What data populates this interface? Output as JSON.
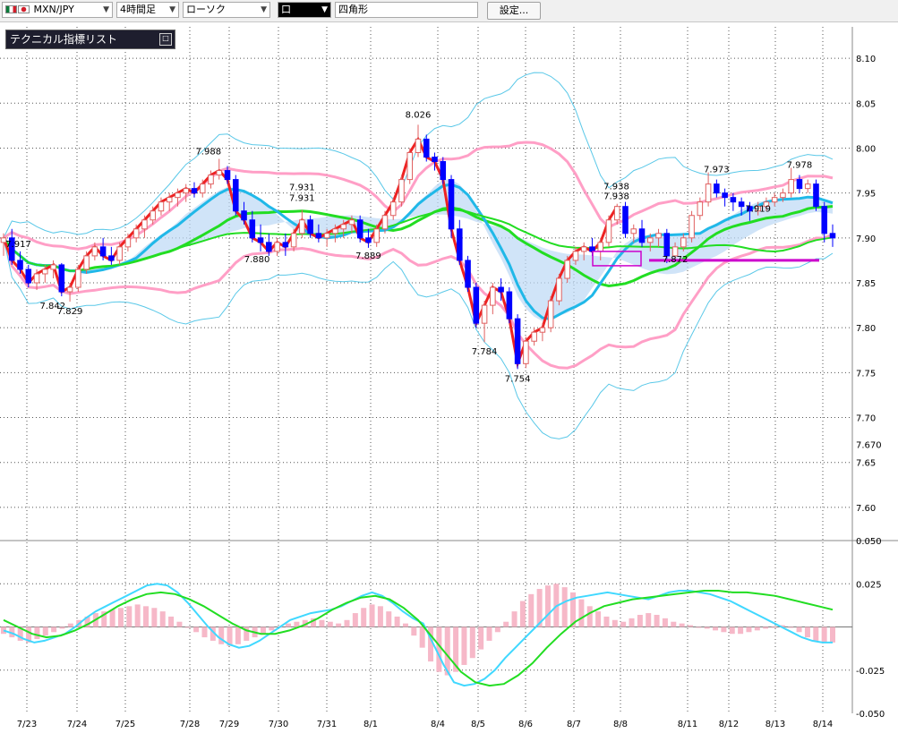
{
  "toolbar": {
    "symbol": "MXN/JPY",
    "timeframe": "4時間足",
    "chart_type": "ローソク",
    "draw_color_label": "口",
    "draw_tool": "四角形",
    "settings_label": "設定..."
  },
  "indicator_panel": {
    "title": "テクニカル指標リスト"
  },
  "colors": {
    "bull": "#ff8a8a",
    "bear": "#0000ff",
    "bb_outer": "#5ac8e8",
    "bb_mid": "#ff9fc6",
    "ma_green": "#22dd22",
    "ma_cyan": "#20b8e8",
    "lagging": "#ee2222",
    "cloud_blue": "#bcd9f5",
    "cloud_pink": "#f8c8da",
    "hist": "#f6b8c8",
    "hline": "#cc00cc"
  },
  "chart_data": [
    {
      "type": "candlestick",
      "y_ticks": [
        "8.10",
        "8.05",
        "8.00",
        "7.95",
        "7.90",
        "7.85",
        "7.80",
        "7.75",
        "7.70",
        "7.670",
        "7.65",
        "7.60"
      ],
      "x_ticks": [
        "7/23",
        "7/24",
        "7/25",
        "7/28",
        "7/29",
        "7/30",
        "7/31",
        "8/1",
        "8/4",
        "8/5",
        "8/6",
        "8/7",
        "8/8",
        "8/11",
        "8/12",
        "8/13",
        "8/14"
      ],
      "ylim": [
        7.565,
        8.135
      ],
      "annotations": [
        "7.917",
        "7.842",
        "7.829",
        "7.988",
        "7.931",
        "7.931",
        "7.880",
        "7.889",
        "8.026",
        "7.784",
        "7.754",
        "7.938",
        "7.938",
        "7.872",
        "7.973",
        "7.919",
        "7.978"
      ],
      "horizontal_line": 7.875,
      "candles": [
        [
          7.895,
          7.905,
          7.88,
          7.9
        ],
        [
          7.9,
          7.91,
          7.87,
          7.875
        ],
        [
          7.875,
          7.885,
          7.86,
          7.865
        ],
        [
          7.865,
          7.87,
          7.845,
          7.85
        ],
        [
          7.85,
          7.865,
          7.842,
          7.86
        ],
        [
          7.86,
          7.87,
          7.85,
          7.865
        ],
        [
          7.865,
          7.875,
          7.855,
          7.87
        ],
        [
          7.87,
          7.872,
          7.835,
          7.84
        ],
        [
          7.84,
          7.85,
          7.829,
          7.845
        ],
        [
          7.845,
          7.87,
          7.84,
          7.865
        ],
        [
          7.865,
          7.885,
          7.86,
          7.88
        ],
        [
          7.88,
          7.895,
          7.875,
          7.89
        ],
        [
          7.89,
          7.9,
          7.875,
          7.88
        ],
        [
          7.88,
          7.89,
          7.87,
          7.875
        ],
        [
          7.875,
          7.895,
          7.87,
          7.89
        ],
        [
          7.89,
          7.905,
          7.885,
          7.9
        ],
        [
          7.9,
          7.915,
          7.895,
          7.91
        ],
        [
          7.91,
          7.925,
          7.9,
          7.92
        ],
        [
          7.92,
          7.935,
          7.915,
          7.93
        ],
        [
          7.93,
          7.945,
          7.925,
          7.94
        ],
        [
          7.94,
          7.95,
          7.93,
          7.945
        ],
        [
          7.945,
          7.955,
          7.935,
          7.95
        ],
        [
          7.95,
          7.96,
          7.94,
          7.955
        ],
        [
          7.955,
          7.962,
          7.945,
          7.95
        ],
        [
          7.95,
          7.965,
          7.945,
          7.96
        ],
        [
          7.96,
          7.975,
          7.955,
          7.97
        ],
        [
          7.97,
          7.988,
          7.965,
          7.975
        ],
        [
          7.975,
          7.98,
          7.96,
          7.965
        ],
        [
          7.965,
          7.97,
          7.925,
          7.93
        ],
        [
          7.93,
          7.94,
          7.915,
          7.92
        ],
        [
          7.92,
          7.93,
          7.895,
          7.9
        ],
        [
          7.9,
          7.915,
          7.885,
          7.895
        ],
        [
          7.895,
          7.905,
          7.88,
          7.885
        ],
        [
          7.885,
          7.9,
          7.88,
          7.895
        ],
        [
          7.895,
          7.905,
          7.88,
          7.89
        ],
        [
          7.89,
          7.91,
          7.885,
          7.905
        ],
        [
          7.905,
          7.931,
          7.9,
          7.92
        ],
        [
          7.92,
          7.925,
          7.9,
          7.905
        ],
        [
          7.905,
          7.915,
          7.895,
          7.9
        ],
        [
          7.9,
          7.91,
          7.89,
          7.905
        ],
        [
          7.905,
          7.915,
          7.895,
          7.91
        ],
        [
          7.91,
          7.92,
          7.9,
          7.915
        ],
        [
          7.915,
          7.925,
          7.905,
          7.92
        ],
        [
          7.92,
          7.925,
          7.895,
          7.9
        ],
        [
          7.9,
          7.91,
          7.889,
          7.895
        ],
        [
          7.895,
          7.915,
          7.89,
          7.91
        ],
        [
          7.91,
          7.93,
          7.905,
          7.925
        ],
        [
          7.925,
          7.945,
          7.92,
          7.94
        ],
        [
          7.94,
          7.97,
          7.935,
          7.965
        ],
        [
          7.965,
          8.0,
          7.96,
          7.995
        ],
        [
          7.995,
          8.026,
          7.99,
          8.01
        ],
        [
          8.01,
          8.015,
          7.985,
          7.99
        ],
        [
          7.99,
          7.995,
          7.975,
          7.985
        ],
        [
          7.985,
          7.99,
          7.96,
          7.965
        ],
        [
          7.965,
          7.97,
          7.9,
          7.91
        ],
        [
          7.91,
          7.92,
          7.87,
          7.875
        ],
        [
          7.875,
          7.88,
          7.84,
          7.845
        ],
        [
          7.845,
          7.85,
          7.8,
          7.805
        ],
        [
          7.805,
          7.83,
          7.784,
          7.825
        ],
        [
          7.825,
          7.85,
          7.815,
          7.845
        ],
        [
          7.845,
          7.855,
          7.83,
          7.84
        ],
        [
          7.84,
          7.845,
          7.805,
          7.81
        ],
        [
          7.81,
          7.815,
          7.754,
          7.76
        ],
        [
          7.76,
          7.79,
          7.755,
          7.785
        ],
        [
          7.785,
          7.8,
          7.78,
          7.795
        ],
        [
          7.795,
          7.805,
          7.785,
          7.8
        ],
        [
          7.8,
          7.835,
          7.795,
          7.83
        ],
        [
          7.83,
          7.86,
          7.825,
          7.855
        ],
        [
          7.855,
          7.88,
          7.85,
          7.875
        ],
        [
          7.875,
          7.89,
          7.87,
          7.885
        ],
        [
          7.885,
          7.895,
          7.875,
          7.89
        ],
        [
          7.89,
          7.9,
          7.88,
          7.885
        ],
        [
          7.885,
          7.9,
          7.875,
          7.895
        ],
        [
          7.895,
          7.925,
          7.89,
          7.92
        ],
        [
          7.92,
          7.938,
          7.915,
          7.935
        ],
        [
          7.935,
          7.94,
          7.9,
          7.905
        ],
        [
          7.905,
          7.915,
          7.895,
          7.91
        ],
        [
          7.91,
          7.92,
          7.89,
          7.895
        ],
        [
          7.895,
          7.905,
          7.885,
          7.9
        ],
        [
          7.9,
          7.91,
          7.89,
          7.905
        ],
        [
          7.905,
          7.91,
          7.872,
          7.88
        ],
        [
          7.88,
          7.895,
          7.875,
          7.89
        ],
        [
          7.89,
          7.905,
          7.885,
          7.9
        ],
        [
          7.9,
          7.93,
          7.895,
          7.925
        ],
        [
          7.925,
          7.945,
          7.92,
          7.94
        ],
        [
          7.94,
          7.973,
          7.935,
          7.96
        ],
        [
          7.96,
          7.965,
          7.945,
          7.95
        ],
        [
          7.95,
          7.955,
          7.935,
          7.945
        ],
        [
          7.945,
          7.95,
          7.93,
          7.94
        ],
        [
          7.94,
          7.945,
          7.925,
          7.935
        ],
        [
          7.935,
          7.94,
          7.919,
          7.93
        ],
        [
          7.93,
          7.94,
          7.925,
          7.935
        ],
        [
          7.935,
          7.945,
          7.93,
          7.94
        ],
        [
          7.94,
          7.95,
          7.935,
          7.945
        ],
        [
          7.945,
          7.955,
          7.94,
          7.95
        ],
        [
          7.95,
          7.978,
          7.945,
          7.965
        ],
        [
          7.965,
          7.97,
          7.95,
          7.955
        ],
        [
          7.955,
          7.965,
          7.95,
          7.96
        ],
        [
          7.96,
          7.965,
          7.93,
          7.935
        ],
        [
          7.935,
          7.94,
          7.895,
          7.905
        ],
        [
          7.905,
          7.915,
          7.89,
          7.9
        ]
      ]
    },
    {
      "type": "macd",
      "y_ticks": [
        "0.050",
        "0.025",
        "-0.025",
        "-0.050"
      ],
      "ylim": [
        -0.05,
        0.05
      ],
      "histogram": [
        -0.004,
        -0.006,
        -0.008,
        -0.009,
        -0.007,
        -0.005,
        -0.003,
        -0.001,
        0.002,
        0.004,
        0.006,
        0.008,
        0.009,
        0.01,
        0.011,
        0.012,
        0.013,
        0.012,
        0.011,
        0.009,
        0.006,
        0.003,
        0.0,
        -0.003,
        -0.006,
        -0.008,
        -0.01,
        -0.011,
        -0.01,
        -0.008,
        -0.006,
        -0.004,
        -0.002,
        0.0,
        0.002,
        0.003,
        0.004,
        0.005,
        0.004,
        0.003,
        0.002,
        0.004,
        0.008,
        0.011,
        0.013,
        0.012,
        0.009,
        0.006,
        0.002,
        -0.005,
        -0.012,
        -0.02,
        -0.026,
        -0.028,
        -0.026,
        -0.022,
        -0.018,
        -0.013,
        -0.008,
        -0.003,
        0.003,
        0.009,
        0.015,
        0.019,
        0.022,
        0.024,
        0.025,
        0.023,
        0.02,
        0.016,
        0.012,
        0.009,
        0.006,
        0.004,
        0.003,
        0.005,
        0.007,
        0.008,
        0.007,
        0.005,
        0.003,
        0.002,
        0.001,
        0.0,
        -0.001,
        -0.002,
        -0.003,
        -0.004,
        -0.004,
        -0.003,
        -0.002,
        -0.001,
        0.0,
        0.001,
        0.0,
        -0.003,
        -0.006,
        -0.008,
        -0.009,
        -0.009
      ],
      "macd": [
        -0.002,
        -0.004,
        -0.007,
        -0.009,
        -0.008,
        -0.006,
        -0.004,
        0.0,
        0.005,
        0.009,
        0.012,
        0.015,
        0.018,
        0.021,
        0.024,
        0.025,
        0.024,
        0.02,
        0.014,
        0.007,
        0.0,
        -0.006,
        -0.01,
        -0.012,
        -0.011,
        -0.008,
        -0.004,
        0.0,
        0.004,
        0.006,
        0.008,
        0.009,
        0.01,
        0.012,
        0.015,
        0.018,
        0.02,
        0.018,
        0.014,
        0.009,
        0.005,
        0.002,
        -0.01,
        -0.022,
        -0.032,
        -0.034,
        -0.033,
        -0.03,
        -0.025,
        -0.018,
        -0.012,
        -0.006,
        0.0,
        0.006,
        0.012,
        0.015,
        0.017,
        0.018,
        0.019,
        0.02,
        0.019,
        0.018,
        0.017,
        0.016,
        0.018,
        0.02,
        0.021,
        0.021,
        0.02,
        0.019,
        0.017,
        0.015,
        0.012,
        0.009,
        0.006,
        0.003,
        0.0,
        -0.003,
        -0.006,
        -0.008,
        -0.009,
        -0.009
      ],
      "signal": [
        0.004,
        0.0,
        -0.004,
        -0.006,
        -0.005,
        -0.002,
        0.002,
        0.007,
        0.012,
        0.016,
        0.019,
        0.02,
        0.019,
        0.016,
        0.012,
        0.007,
        0.002,
        -0.002,
        -0.004,
        -0.004,
        -0.002,
        0.001,
        0.005,
        0.01,
        0.014,
        0.017,
        0.018,
        0.016,
        0.011,
        0.004,
        -0.006,
        -0.016,
        -0.026,
        -0.032,
        -0.034,
        -0.033,
        -0.028,
        -0.021,
        -0.012,
        -0.004,
        0.003,
        0.008,
        0.012,
        0.014,
        0.016,
        0.017,
        0.018,
        0.019,
        0.02,
        0.021,
        0.021,
        0.02,
        0.02,
        0.019,
        0.018,
        0.016,
        0.014,
        0.012,
        0.01
      ]
    }
  ]
}
